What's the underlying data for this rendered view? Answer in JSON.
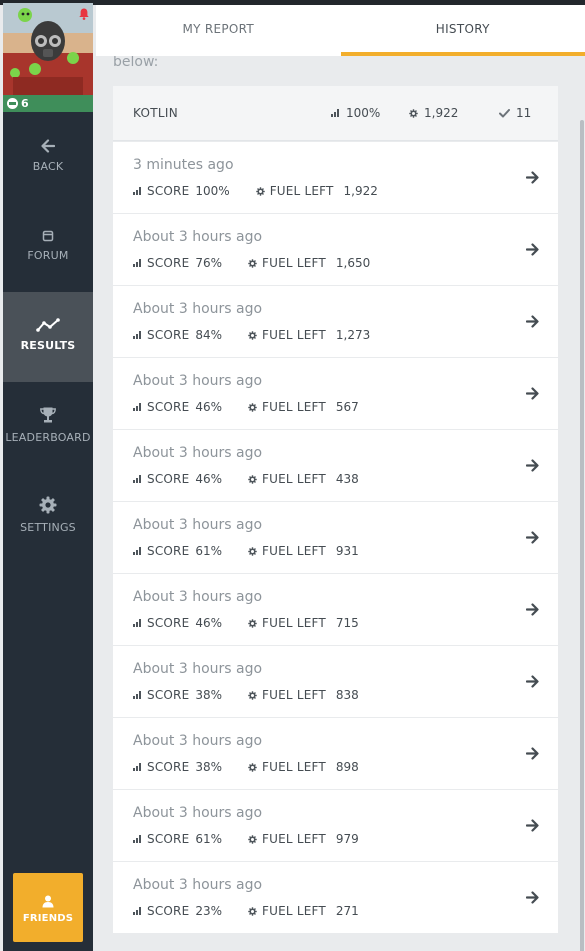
{
  "sidebar": {
    "badge_count": "6",
    "items": [
      {
        "label": "BACK"
      },
      {
        "label": "FORUM"
      },
      {
        "label": "RESULTS"
      },
      {
        "label": "LEADERBOARD"
      },
      {
        "label": "SETTINGS"
      }
    ],
    "friends_label": "FRIENDS"
  },
  "tabs": [
    {
      "label": "MY REPORT"
    },
    {
      "label": "HISTORY"
    }
  ],
  "intro_text": "below:",
  "summary": {
    "language": "KOTLIN",
    "score": "100%",
    "fuel": "1,922",
    "count": "11"
  },
  "history_labels": {
    "score": "SCORE",
    "fuel": "FUEL LEFT"
  },
  "history": [
    {
      "when": "3 minutes ago",
      "score": "100%",
      "fuel": "1,922"
    },
    {
      "when": "About 3 hours ago",
      "score": "76%",
      "fuel": "1,650"
    },
    {
      "when": "About 3 hours ago",
      "score": "84%",
      "fuel": "1,273"
    },
    {
      "when": "About 3 hours ago",
      "score": "46%",
      "fuel": "567"
    },
    {
      "when": "About 3 hours ago",
      "score": "46%",
      "fuel": "438"
    },
    {
      "when": "About 3 hours ago",
      "score": "61%",
      "fuel": "931"
    },
    {
      "when": "About 3 hours ago",
      "score": "46%",
      "fuel": "715"
    },
    {
      "when": "About 3 hours ago",
      "score": "38%",
      "fuel": "838"
    },
    {
      "when": "About 3 hours ago",
      "score": "38%",
      "fuel": "898"
    },
    {
      "when": "About 3 hours ago",
      "score": "61%",
      "fuel": "979"
    },
    {
      "when": "About 3 hours ago",
      "score": "23%",
      "fuel": "271"
    }
  ],
  "colors": {
    "accent": "#f2ae2c",
    "sidebar": "#252e38",
    "badge": "#3f8e5a",
    "notification": "#e8343f"
  }
}
